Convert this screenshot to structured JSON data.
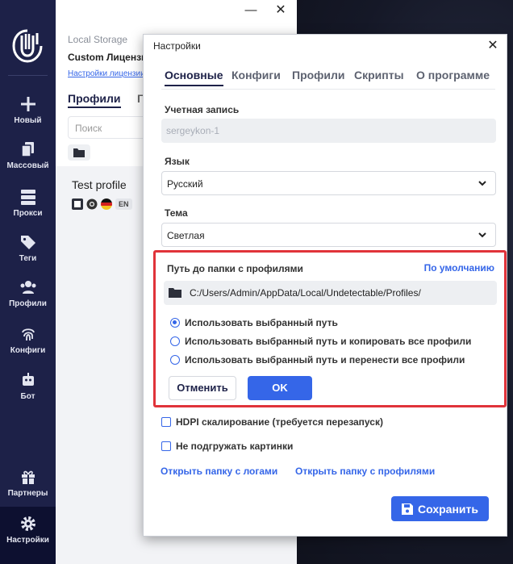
{
  "window": {
    "minimize_label": "—",
    "close_label": "✕"
  },
  "sidebar": {
    "items": [
      {
        "id": "new",
        "label": "Новый",
        "icon": "plus-icon"
      },
      {
        "id": "bulk",
        "label": "Массовый",
        "icon": "copy-icon"
      },
      {
        "id": "proxy",
        "label": "Прокси",
        "icon": "server-icon"
      },
      {
        "id": "tags",
        "label": "Теги",
        "icon": "tags-icon"
      },
      {
        "id": "profiles",
        "label": "Профили",
        "icon": "users-icon"
      },
      {
        "id": "configs",
        "label": "Конфиги",
        "icon": "fingerprint-icon"
      },
      {
        "id": "bot",
        "label": "Бот",
        "icon": "robot-icon"
      },
      {
        "id": "partners",
        "label": "Партнеры",
        "icon": "gift-icon"
      },
      {
        "id": "settings",
        "label": "Настройки",
        "icon": "gear-icon",
        "active": true
      }
    ]
  },
  "main": {
    "storage_label": "Local Storage",
    "license_name": "Custom Лицензия",
    "license_link": "Настройки лицензии",
    "tabs": [
      "Профили",
      "Г"
    ],
    "search_placeholder": "Поиск",
    "profile": {
      "name": "Test profile",
      "lang": "EN"
    }
  },
  "dialog": {
    "title": "Настройки",
    "close_label": "✕",
    "tabs": [
      "Основные",
      "Конфиги",
      "Профили",
      "Скрипты",
      "О программе"
    ],
    "account": {
      "label": "Учетная запись",
      "value": "sergeykon-1"
    },
    "language": {
      "label": "Язык",
      "value": "Русский"
    },
    "theme": {
      "label": "Тема",
      "value": "Светлая"
    },
    "profiles_path": {
      "label": "Путь до папки с профилями",
      "default_link": "По умолчанию",
      "value": "C:/Users/Admin/AppData/Local/Undetectable/Profiles/",
      "options": [
        {
          "label": "Использовать выбранный путь",
          "selected": true
        },
        {
          "label": "Использовать выбранный путь и копировать все профили",
          "selected": false
        },
        {
          "label": "Использовать выбранный путь и перенести все профили",
          "selected": false
        }
      ],
      "cancel_label": "Отменить",
      "ok_label": "OK"
    },
    "hdpi_label": "HDPI скалирование (требуется перезапуск)",
    "no_images_label": "Не подгружать картинки",
    "open_logs_link": "Открыть папку с логами",
    "open_profiles_link": "Открыть папку с профилями",
    "save_label": "Сохранить"
  },
  "colors": {
    "accent": "#3566e8",
    "sidebar": "#1d2148",
    "highlight_border": "#e0333a"
  }
}
